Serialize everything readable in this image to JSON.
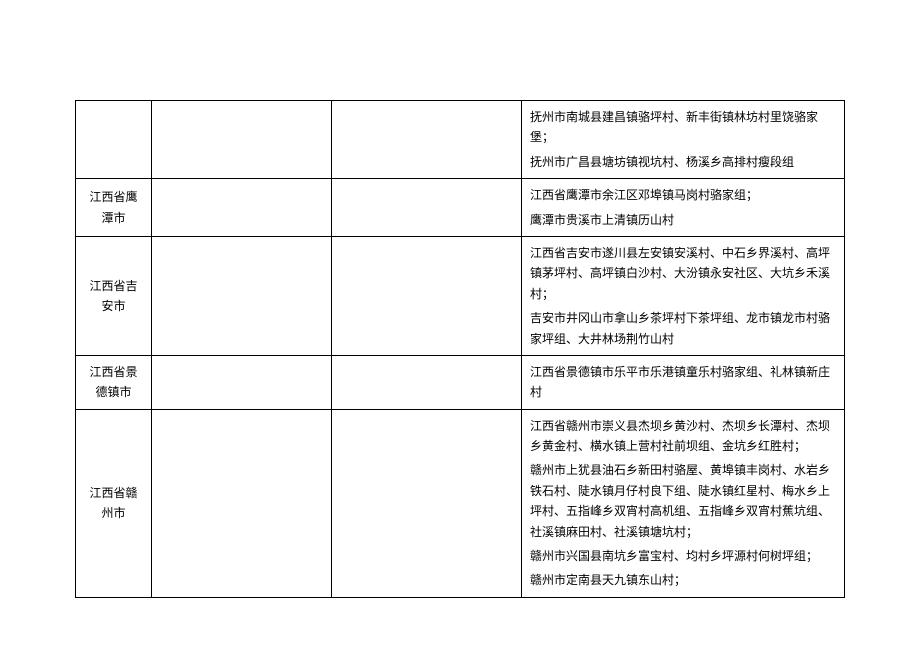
{
  "rows": [
    {
      "city": "",
      "col2": "",
      "col3": "",
      "details": [
        "抚州市南城县建昌镇骆坪村、新丰街镇林坊村里饶骆家堡；",
        "抚州市广昌县塘坊镇视坑村、杨溪乡高排村瘦段组"
      ]
    },
    {
      "city": "江西省鹰潭市",
      "col2": "",
      "col3": "",
      "details": [
        "江西省鹰潭市余江区邓埠镇马岗村骆家组；",
        "鹰潭市贵溪市上清镇历山村"
      ]
    },
    {
      "city": "江西省吉安市",
      "col2": "",
      "col3": "",
      "details": [
        "江西省吉安市遂川县左安镇安溪村、中石乡界溪村、高坪镇茅坪村、高坪镇白沙村、大汾镇永安社区、大坑乡禾溪村；",
        "吉安市井冈山市拿山乡茶坪村下茶坪组、龙市镇龙市村骆家坪组、大井林场荆竹山村"
      ]
    },
    {
      "city": "江西省景德镇市",
      "col2": "",
      "col3": "",
      "details": [
        "江西省景德镇市乐平市乐港镇童乐村骆家组、礼林镇新庄村"
      ]
    },
    {
      "city": "江西省赣州市",
      "col2": "",
      "col3": "",
      "details": [
        "江西省赣州市崇义县杰坝乡黄沙村、杰坝乡长潭村、杰坝乡黄金村、横水镇上营村社前坝组、金坑乡红胜村；",
        "赣州市上犹县油石乡新田村骆屋、黄埠镇丰岗村、水岩乡铁石村、陡水镇月仔村良下组、陡水镇红星村、梅水乡上坪村、五指峰乡双宵村高机组、五指峰乡双宵村蕉坑组、社溪镇麻田村、社溪镇塘坑村；",
        "赣州市兴国县南坑乡富宝村、均村乡坪源村何树坪组；",
        "赣州市定南县天九镇东山村；"
      ]
    }
  ]
}
